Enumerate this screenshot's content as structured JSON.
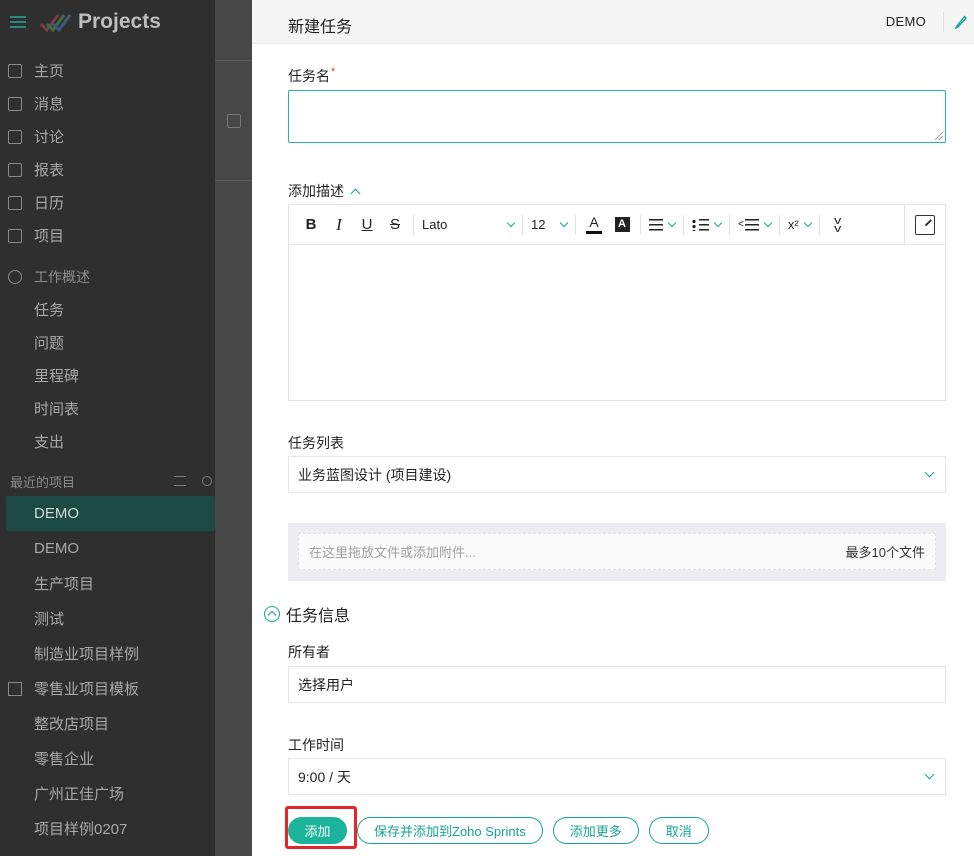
{
  "app": {
    "title": "Projects",
    "accent": "#1bb39b"
  },
  "sidebar": {
    "nav": [
      {
        "label": "主页",
        "icon": "home-icon"
      },
      {
        "label": "消息",
        "icon": "feed-icon"
      },
      {
        "label": "讨论",
        "icon": "discuss-icon"
      },
      {
        "label": "报表",
        "icon": "reports-icon"
      },
      {
        "label": "日历",
        "icon": "calendar-icon"
      },
      {
        "label": "项目",
        "icon": "projects-icon"
      }
    ],
    "work_overview": {
      "label": "工作概述",
      "items": [
        "任务",
        "问题",
        "里程碑",
        "时间表",
        "支出"
      ]
    },
    "recent": {
      "label": "最近的项目",
      "items": [
        "DEMO",
        "DEMO",
        "生产项目",
        "测试",
        "制造业项目样例",
        "零售业项目模板",
        "整改店项目",
        "零售企业",
        "广州正佳广场",
        "项目样例0207"
      ],
      "active_index": 0
    }
  },
  "panel": {
    "title": "新建任务",
    "project": "DEMO",
    "task_name": {
      "label": "任务名",
      "required_mark": "*",
      "value": ""
    },
    "description": {
      "label": "添加描述",
      "toolbar": {
        "bold": "B",
        "italic": "I",
        "underline": "U",
        "strike": "S",
        "font": "Lato",
        "size": "12",
        "font_color": "A",
        "bg_color": "A",
        "superscript": "x²"
      }
    },
    "task_list": {
      "label": "任务列表",
      "value": "业务蓝图设计 (项目建设)"
    },
    "attachment": {
      "placeholder": "在这里拖放文件或添加附件...",
      "limit": "最多10个文件"
    },
    "task_info": {
      "label": "任务信息",
      "owner": {
        "label": "所有者",
        "value": "选择用户"
      },
      "work_time": {
        "label": "工作时间",
        "value": "9:00 / 天"
      }
    },
    "buttons": {
      "add": "添加",
      "save_sprints": "保存并添加到Zoho Sprints",
      "add_more": "添加更多",
      "cancel": "取消"
    }
  }
}
